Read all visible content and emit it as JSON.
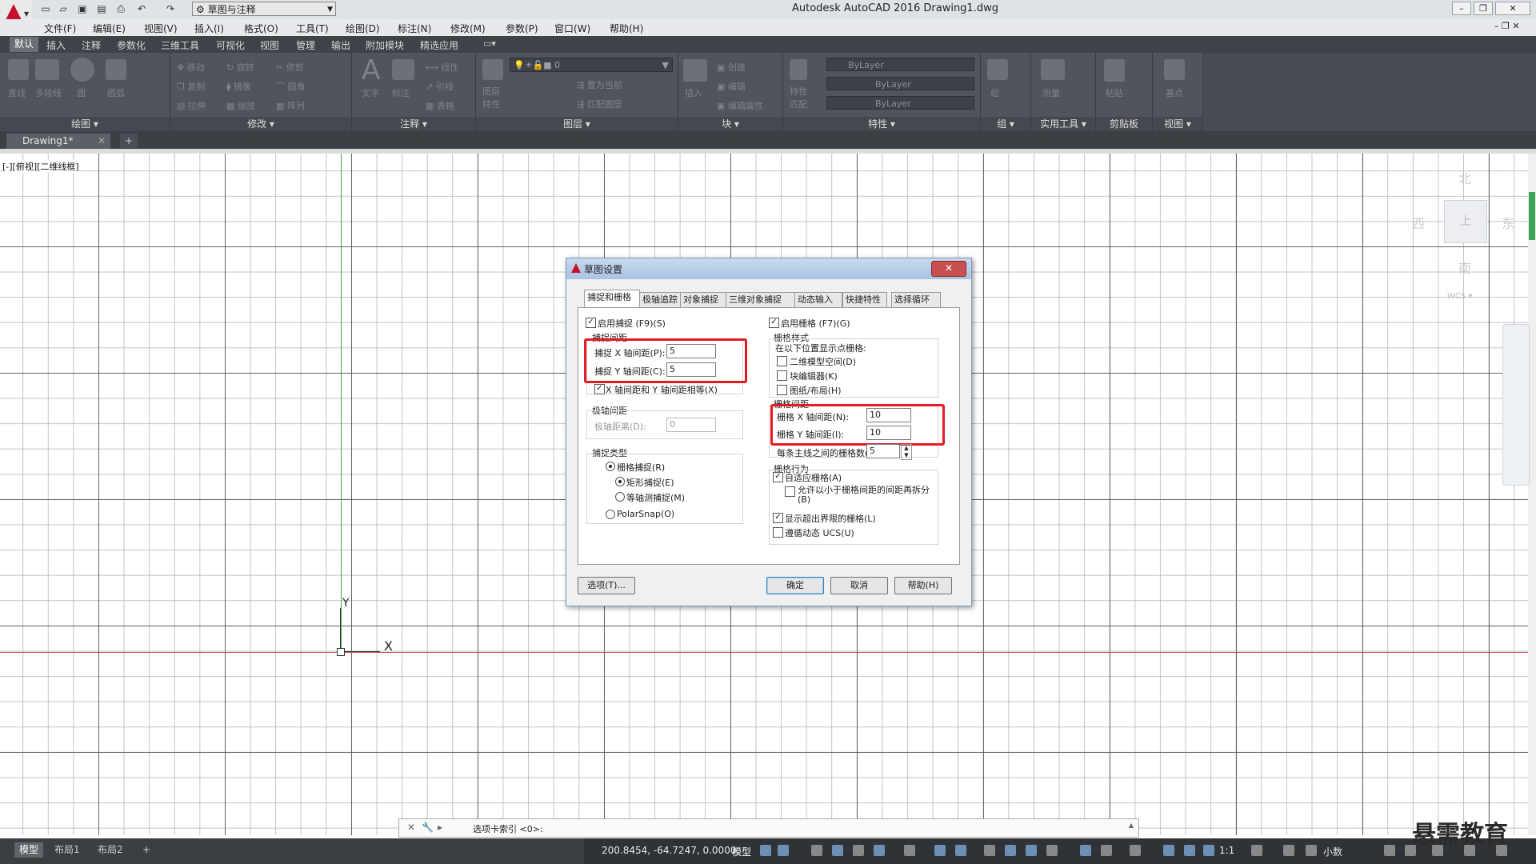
{
  "window": {
    "title": "Autodesk AutoCAD 2016    Drawing1.dwg",
    "workspace": "草图与注释"
  },
  "menu": [
    "文件(F)",
    "编辑(E)",
    "视图(V)",
    "插入(I)",
    "格式(O)",
    "工具(T)",
    "绘图(D)",
    "标注(N)",
    "修改(M)",
    "参数(P)",
    "窗口(W)",
    "帮助(H)"
  ],
  "ribbon_tabs": [
    "默认",
    "插入",
    "注释",
    "参数化",
    "三维工具",
    "可视化",
    "视图",
    "管理",
    "输出",
    "附加模块",
    "精选应用"
  ],
  "ribbon": {
    "panels": [
      "绘图",
      "修改",
      "注释",
      "图层",
      "块",
      "特性",
      "组",
      "实用工具",
      "剪贴板",
      "视图"
    ],
    "draw_tools": [
      "直线",
      "多段线",
      "圆",
      "圆弧"
    ],
    "modify_tools": [
      "移动",
      "旋转",
      "修剪",
      "复制",
      "镜像",
      "圆角",
      "拉伸",
      "缩放",
      "阵列"
    ],
    "annot_tools": [
      "文字",
      "标注",
      "线性",
      "引线",
      "表格"
    ],
    "layer_value": "0",
    "layer_tools": [
      "图层特性",
      "置为当前",
      "匹配图层"
    ],
    "block_tools": [
      "插入",
      "创建",
      "编辑",
      "编辑属性"
    ],
    "props": [
      "ByLayer",
      "ByLayer",
      "ByLayer"
    ],
    "props_tools": [
      "特性匹配"
    ],
    "group_tools": [
      "组"
    ],
    "util_tools": [
      "测量"
    ],
    "clip_tools": [
      "粘贴"
    ],
    "view_tools": [
      "基点"
    ]
  },
  "doc_tab": "Drawing1*",
  "viewport_label": "[-][俯视][二维线框]",
  "viewcube": {
    "north": "北",
    "south": "南",
    "east": "东",
    "west": "西",
    "top": "上",
    "wcs": "WCS"
  },
  "ucs": {
    "x": "X",
    "y": "Y"
  },
  "dialog": {
    "title": "草图设置",
    "tabs": [
      "捕捉和栅格",
      "极轴追踪",
      "对象捕捉",
      "三维对象捕捉",
      "动态输入",
      "快捷特性",
      "选择循环"
    ],
    "snap_on": "启用捕捉 (F9)(S)",
    "snap_spacing": "捕捉间距",
    "snap_x_label": "捕捉 X 轴间距(P):",
    "snap_x": "5",
    "snap_y_label": "捕捉 Y 轴间距(C):",
    "snap_y": "5",
    "equal_xy": "X 轴间距和 Y 轴间距相等(X)",
    "polar_spacing": "极轴间距",
    "polar_dist_label": "极轴距离(D):",
    "polar_dist": "0",
    "snap_type": "捕捉类型",
    "grid_snap": "栅格捕捉(R)",
    "rect_snap": "矩形捕捉(E)",
    "iso_snap": "等轴测捕捉(M)",
    "polar_snap": "PolarSnap(O)",
    "grid_on": "启用栅格 (F7)(G)",
    "grid_style": "栅格样式",
    "grid_style_desc": "在以下位置显示点栅格:",
    "gs_model": "二维模型空间(D)",
    "gs_block": "块编辑器(K)",
    "gs_sheet": "图纸/布局(H)",
    "grid_spacing": "栅格间距",
    "grid_x_label": "栅格 X 轴间距(N):",
    "grid_x": "10",
    "grid_y_label": "栅格 Y 轴间距(I):",
    "grid_y": "10",
    "major_label": "每条主线之间的栅格数(J):",
    "major": "5",
    "grid_behavior": "栅格行为",
    "adaptive": "自适应栅格(A)",
    "subdivide": "允许以小于栅格间距的间距再拆分(B)",
    "beyond": "显示超出界限的栅格(L)",
    "dyn_ucs": "遵循动态 UCS(U)",
    "options_btn": "选项(T)...",
    "ok": "确定",
    "cancel": "取消",
    "help": "帮助(H)"
  },
  "command": {
    "prompt": "选项卡索引 <0>:"
  },
  "status": {
    "layouts": [
      "模型",
      "布局1",
      "布局2"
    ],
    "coords": "200.8454, -64.7247, 0.0000",
    "mode": "模型",
    "scale": "1:1",
    "units": "小数"
  },
  "watermark": "悬需教育"
}
